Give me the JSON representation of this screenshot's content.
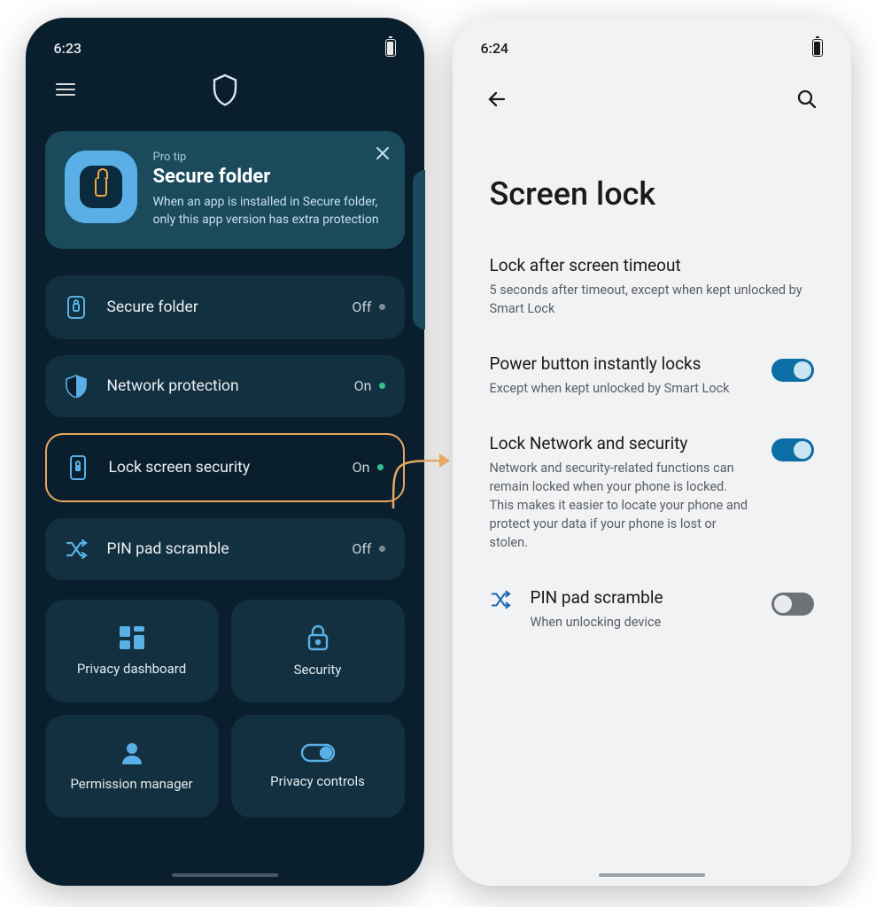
{
  "left": {
    "time": "6:23",
    "protip": {
      "label": "Pro tip",
      "title": "Secure folder",
      "desc": "When an app is installed in Secure folder, only this app version has extra protection"
    },
    "items": [
      {
        "label": "Secure folder",
        "status": "Off",
        "dot": "off"
      },
      {
        "label": "Network protection",
        "status": "On",
        "dot": "on"
      },
      {
        "label": "Lock screen security",
        "status": "On",
        "dot": "on"
      },
      {
        "label": "PIN pad scramble",
        "status": "Off",
        "dot": "off"
      }
    ],
    "tiles": [
      "Privacy dashboard",
      "Security",
      "Permission manager",
      "Privacy controls"
    ]
  },
  "right": {
    "time": "6:24",
    "title": "Screen lock",
    "rows": [
      {
        "title": "Lock after screen timeout",
        "sub": "5 seconds after timeout, except when kept unlocked by Smart Lock",
        "toggle": null
      },
      {
        "title": "Power button instantly locks",
        "sub": "Except when kept unlocked by Smart Lock",
        "toggle": "on"
      },
      {
        "title": "Lock Network and security",
        "sub": "Network and security-related functions can remain locked when your phone is locked. This makes it easier to locate your phone and protect your data if your phone is lost or stolen.",
        "toggle": "on"
      },
      {
        "title": "PIN pad scramble",
        "sub": "When unlocking device",
        "toggle": "off",
        "icon": true
      }
    ]
  }
}
